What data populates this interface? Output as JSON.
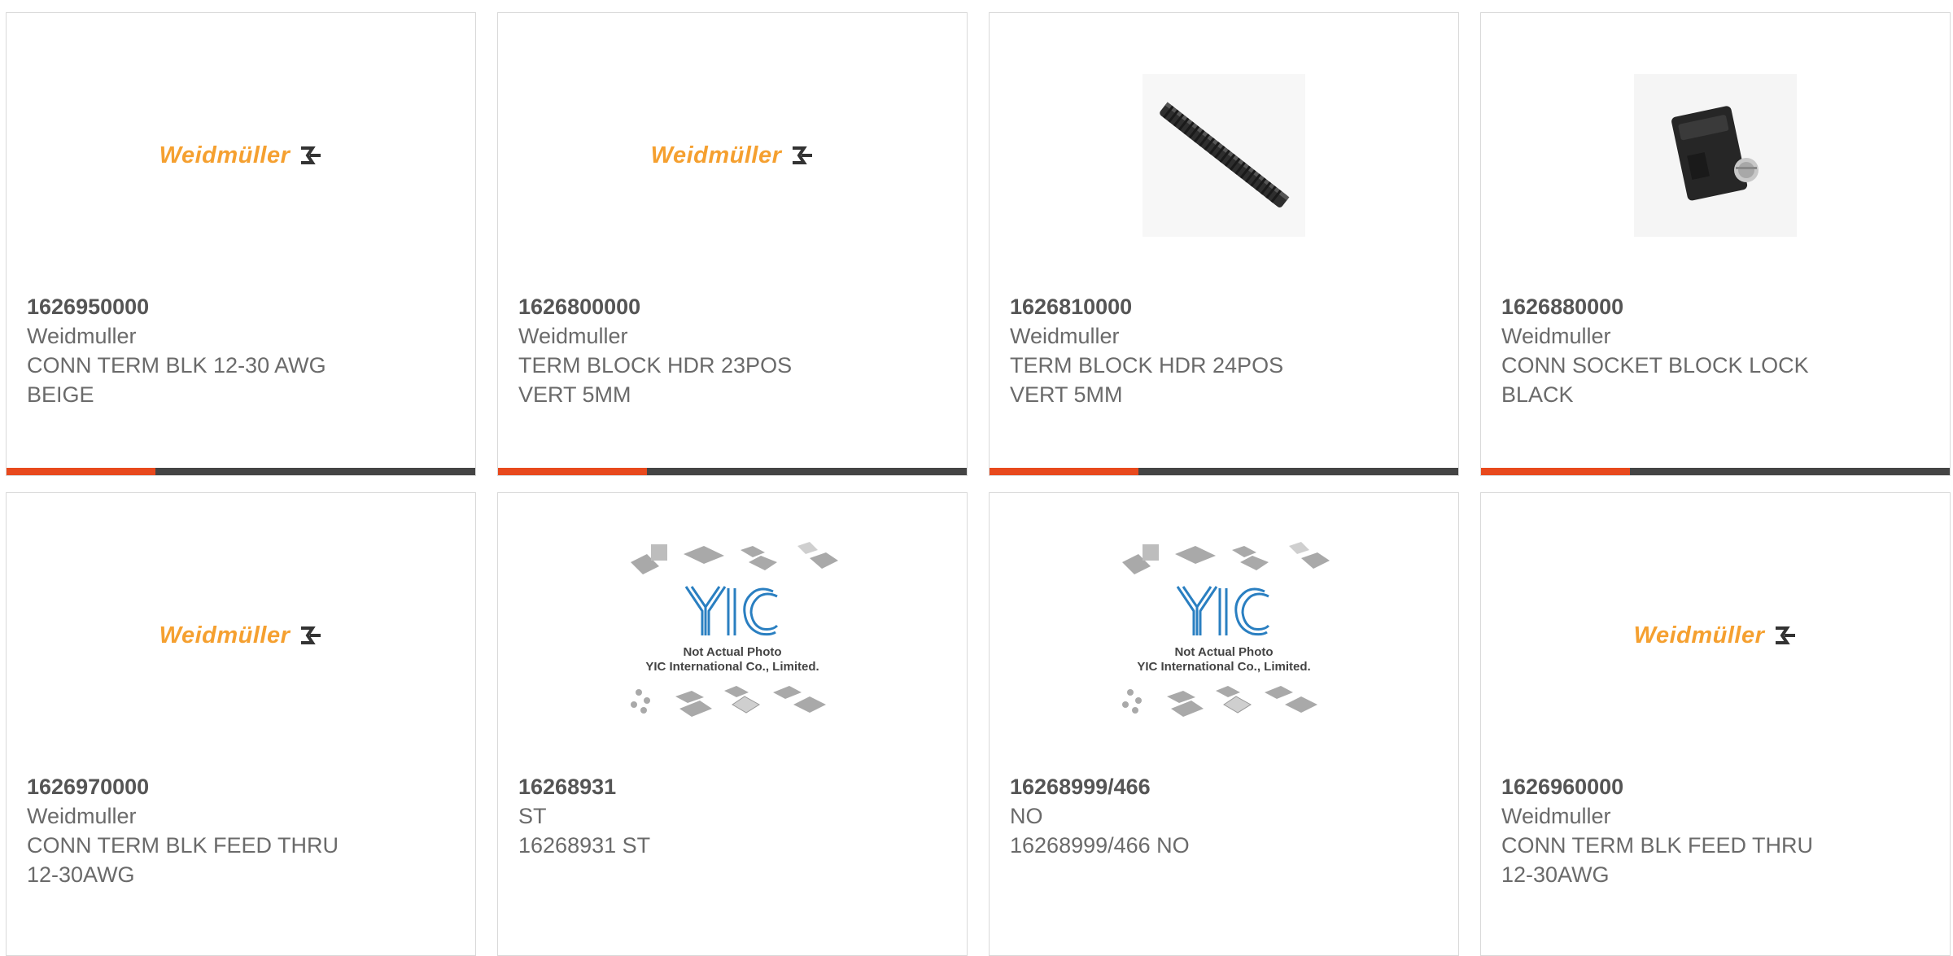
{
  "products": [
    {
      "part_number": "1626950000",
      "manufacturer": "Weidmuller",
      "desc_line1": "CONN TERM BLK 12-30 AWG",
      "desc_line2": "BEIGE",
      "image": "weidmuller-logo",
      "logo_text": "Weidmüller"
    },
    {
      "part_number": "1626800000",
      "manufacturer": "Weidmuller",
      "desc_line1": "TERM BLOCK HDR 23POS",
      "desc_line2": "VERT 5MM",
      "image": "weidmuller-logo",
      "logo_text": "Weidmüller"
    },
    {
      "part_number": "1626810000",
      "manufacturer": "Weidmuller",
      "desc_line1": "TERM BLOCK HDR 24POS",
      "desc_line2": "VERT 5MM",
      "image": "header-strip-photo"
    },
    {
      "part_number": "1626880000",
      "manufacturer": "Weidmuller",
      "desc_line1": "CONN SOCKET BLOCK LOCK",
      "desc_line2": "BLACK",
      "image": "socket-lock-photo"
    },
    {
      "part_number": "1626970000",
      "manufacturer": "Weidmuller",
      "desc_line1": "CONN TERM BLK FEED THRU",
      "desc_line2": "12-30AWG",
      "image": "weidmuller-logo",
      "logo_text": "Weidmüller"
    },
    {
      "part_number": "16268931",
      "manufacturer": "ST",
      "desc_line1": "16268931 ST",
      "desc_line2": "",
      "image": "yic-placeholder",
      "placeholder_line1": "Not Actual Photo",
      "placeholder_line2": "YIC International Co., Limited."
    },
    {
      "part_number": "16268999/466",
      "manufacturer": "NO",
      "desc_line1": "16268999/466 NO",
      "desc_line2": "",
      "image": "yic-placeholder",
      "placeholder_line1": "Not Actual Photo",
      "placeholder_line2": "YIC International Co., Limited."
    },
    {
      "part_number": "1626960000",
      "manufacturer": "Weidmuller",
      "desc_line1": "CONN TERM BLK FEED THRU",
      "desc_line2": "12-30AWG",
      "image": "weidmuller-logo",
      "logo_text": "Weidmüller"
    }
  ],
  "colors": {
    "accent_bar": "#e8491d",
    "bar_rest": "#444444",
    "logo_orange": "#f5a030",
    "yic_blue": "#2a7fc1"
  }
}
